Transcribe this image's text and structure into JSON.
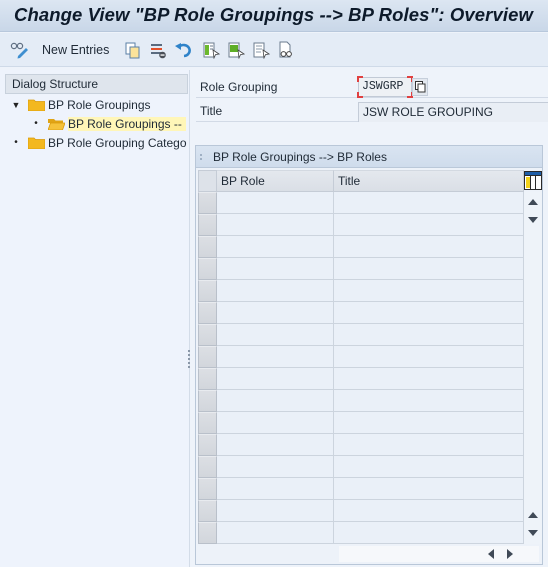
{
  "window": {
    "title": "Change View \"BP Role Groupings --> BP Roles\": Overview"
  },
  "toolbar": {
    "items": [
      {
        "name": "display-change-toggle",
        "icon": "glasses-pencil-icon"
      },
      {
        "name": "new-entries",
        "label": "New Entries"
      },
      {
        "name": "copy-as",
        "icon": "copy-icon"
      },
      {
        "name": "delete",
        "icon": "delete-row-icon"
      },
      {
        "name": "undo-change",
        "icon": "undo-icon"
      },
      {
        "name": "select-all",
        "icon": "select-all-icon"
      },
      {
        "name": "select-block",
        "icon": "select-block-icon"
      },
      {
        "name": "deselect-all",
        "icon": "deselect-all-icon"
      },
      {
        "name": "print-field-help",
        "icon": "glasses-document-icon"
      }
    ]
  },
  "dialog_structure": {
    "header": "Dialog Structure",
    "items": [
      {
        "label": "BP Role Groupings",
        "level": 0,
        "expanded": true,
        "selected": false,
        "icon": "folder-icon"
      },
      {
        "label": "BP Role Groupings --> BP Roles",
        "display_label": "BP Role Groupings --",
        "level": 1,
        "expanded": false,
        "selected": true,
        "icon": "folder-open-icon"
      },
      {
        "label": "BP Role Grouping Categories",
        "display_label": "BP Role Grouping Catego",
        "level": 0,
        "expanded": false,
        "selected": false,
        "icon": "folder-icon"
      }
    ]
  },
  "header_fields": {
    "role_grouping": {
      "label": "Role Grouping",
      "value": "JSWGRP"
    },
    "title": {
      "label": "Title",
      "value": "JSW ROLE GROUPING"
    }
  },
  "table": {
    "caption": "BP Role Groupings --> BP Roles",
    "columns": [
      {
        "key": "bp_role",
        "label": "BP Role"
      },
      {
        "key": "title",
        "label": "Title"
      }
    ],
    "rows": [
      {
        "bp_role": "",
        "title": ""
      },
      {
        "bp_role": "",
        "title": ""
      },
      {
        "bp_role": "",
        "title": ""
      },
      {
        "bp_role": "",
        "title": ""
      },
      {
        "bp_role": "",
        "title": ""
      },
      {
        "bp_role": "",
        "title": ""
      },
      {
        "bp_role": "",
        "title": ""
      },
      {
        "bp_role": "",
        "title": ""
      },
      {
        "bp_role": "",
        "title": ""
      },
      {
        "bp_role": "",
        "title": ""
      },
      {
        "bp_role": "",
        "title": ""
      },
      {
        "bp_role": "",
        "title": ""
      },
      {
        "bp_role": "",
        "title": ""
      },
      {
        "bp_role": "",
        "title": ""
      },
      {
        "bp_role": "",
        "title": ""
      },
      {
        "bp_role": "",
        "title": ""
      }
    ],
    "column_settings_icon": "table-settings-icon"
  },
  "colors": {
    "title_bg": "#d3dfee",
    "selected_node_bg": "#fff6b8",
    "folder": "#f3b81f",
    "key_field_marker": "#e04040"
  }
}
